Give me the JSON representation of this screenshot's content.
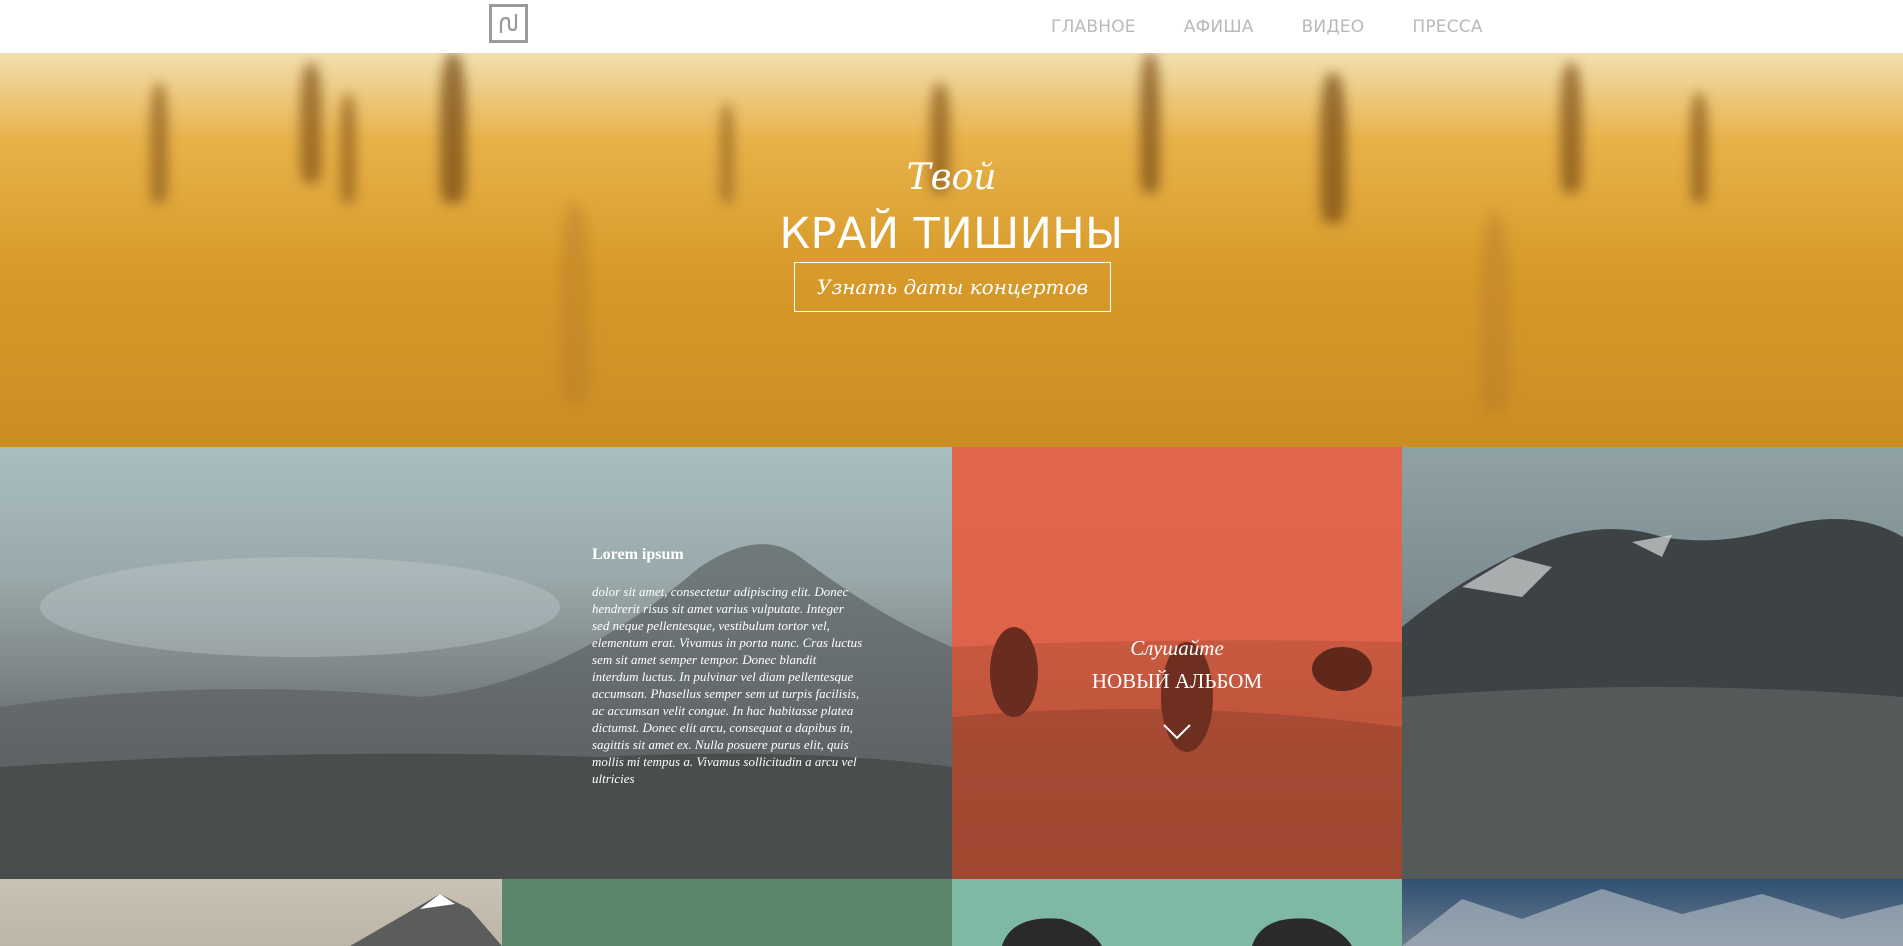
{
  "nav": {
    "items": [
      "ГЛАВНОЕ",
      "АФИША",
      "ВИДЕО",
      "ПРЕССА"
    ]
  },
  "hero": {
    "small": "Твой",
    "big": "КРАЙ ТИШИНЫ",
    "button": "Узнать даты концертов"
  },
  "tile_left": {
    "title": "Lorem ipsum",
    "body": "dolor sit amet, consectetur adipiscing elit. Donec hendrerit risus sit amet varius vulputate. Integer sed neque pellentesque, vestibulum tortor vel, elementum erat. Vivamus in porta nunc. Cras luctus sem sit amet semper tempor. Donec blandit interdum luctus. In pulvinar vel diam pellentesque accumsan. Phasellus semper sem ut turpis facilisis, ac accumsan velit congue. In hac habitasse platea dictumst. Donec elit arcu, consequat a dapibus in, sagittis sit amet ex. Nulla posuere purus elit, quis mollis mi tempus a. Vivamus sollicitudin a arcu vel ultricies"
  },
  "tile_mid": {
    "small": "Слушайте",
    "big": "НОВЫЙ АЛЬБОМ",
    "icon": "chevron-down-icon"
  },
  "colors": {
    "nav_text": "#b9b9b9",
    "album_tile": "#e0664b",
    "green_tile": "#5c866c",
    "mint_tile": "#7fb9a3"
  }
}
